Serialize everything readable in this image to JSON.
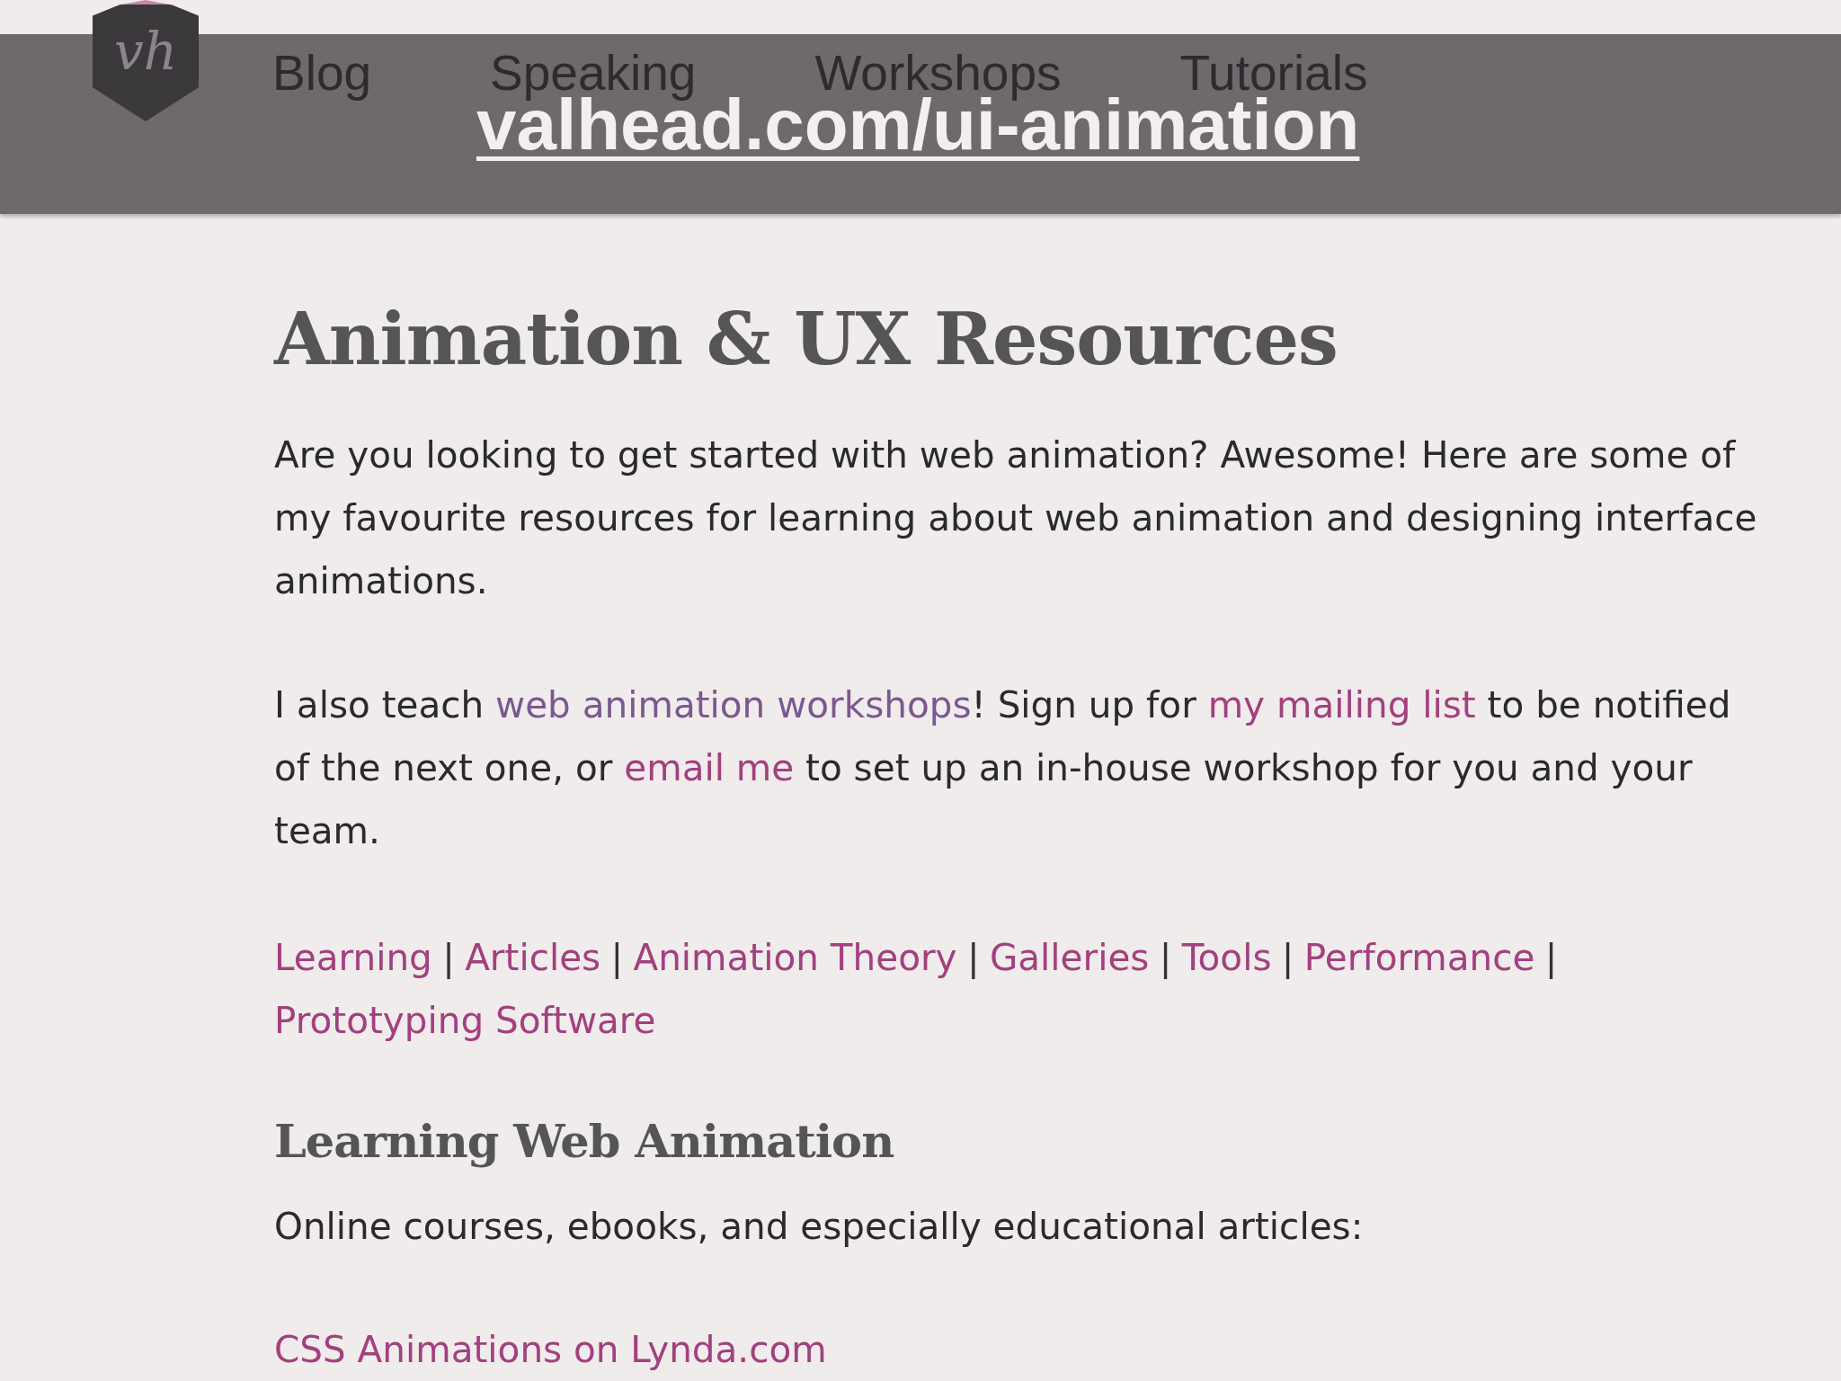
{
  "logo": {
    "monogram": "vh"
  },
  "nav": {
    "items": [
      {
        "label": "Blog"
      },
      {
        "label": "Speaking"
      },
      {
        "label": "Workshops"
      },
      {
        "label": "Tutorials"
      }
    ]
  },
  "caption": {
    "link": "valhead.com/ui-animation"
  },
  "page": {
    "title": "Animation & UX Resources",
    "intro": "Are you looking to get started with web animation? Awesome! Here are some of my favourite resources for learning about web animation and designing interface animations.",
    "workshop_note": [
      {
        "kind": "text",
        "text": "I also teach "
      },
      {
        "kind": "link",
        "text": "web animation workshops",
        "visited": true
      },
      {
        "kind": "text",
        "text": "! Sign up for "
      },
      {
        "kind": "link",
        "text": "my mailing list",
        "visited": false
      },
      {
        "kind": "text",
        "text": " to be notified of the next one, or "
      },
      {
        "kind": "link",
        "text": "email me",
        "visited": false
      },
      {
        "kind": "text",
        "text": " to set up an in-house workshop for you and your team."
      }
    ],
    "section_links": [
      {
        "label": "Learning",
        "separator": "|"
      },
      {
        "label": "Articles",
        "separator": "|"
      },
      {
        "label": "Animation Theory",
        "separator": "|"
      },
      {
        "label": "Galleries",
        "separator": "|"
      },
      {
        "label": "Tools",
        "separator": "|"
      },
      {
        "label": "Performance",
        "separator": "|"
      },
      {
        "label": "Prototyping Software"
      }
    ],
    "sections": [
      {
        "heading": "Learning Web Animation",
        "description": "Online courses, ebooks, and especially educational articles:",
        "links": [
          {
            "label": "CSS Animations on Lynda.com"
          }
        ]
      }
    ]
  }
}
